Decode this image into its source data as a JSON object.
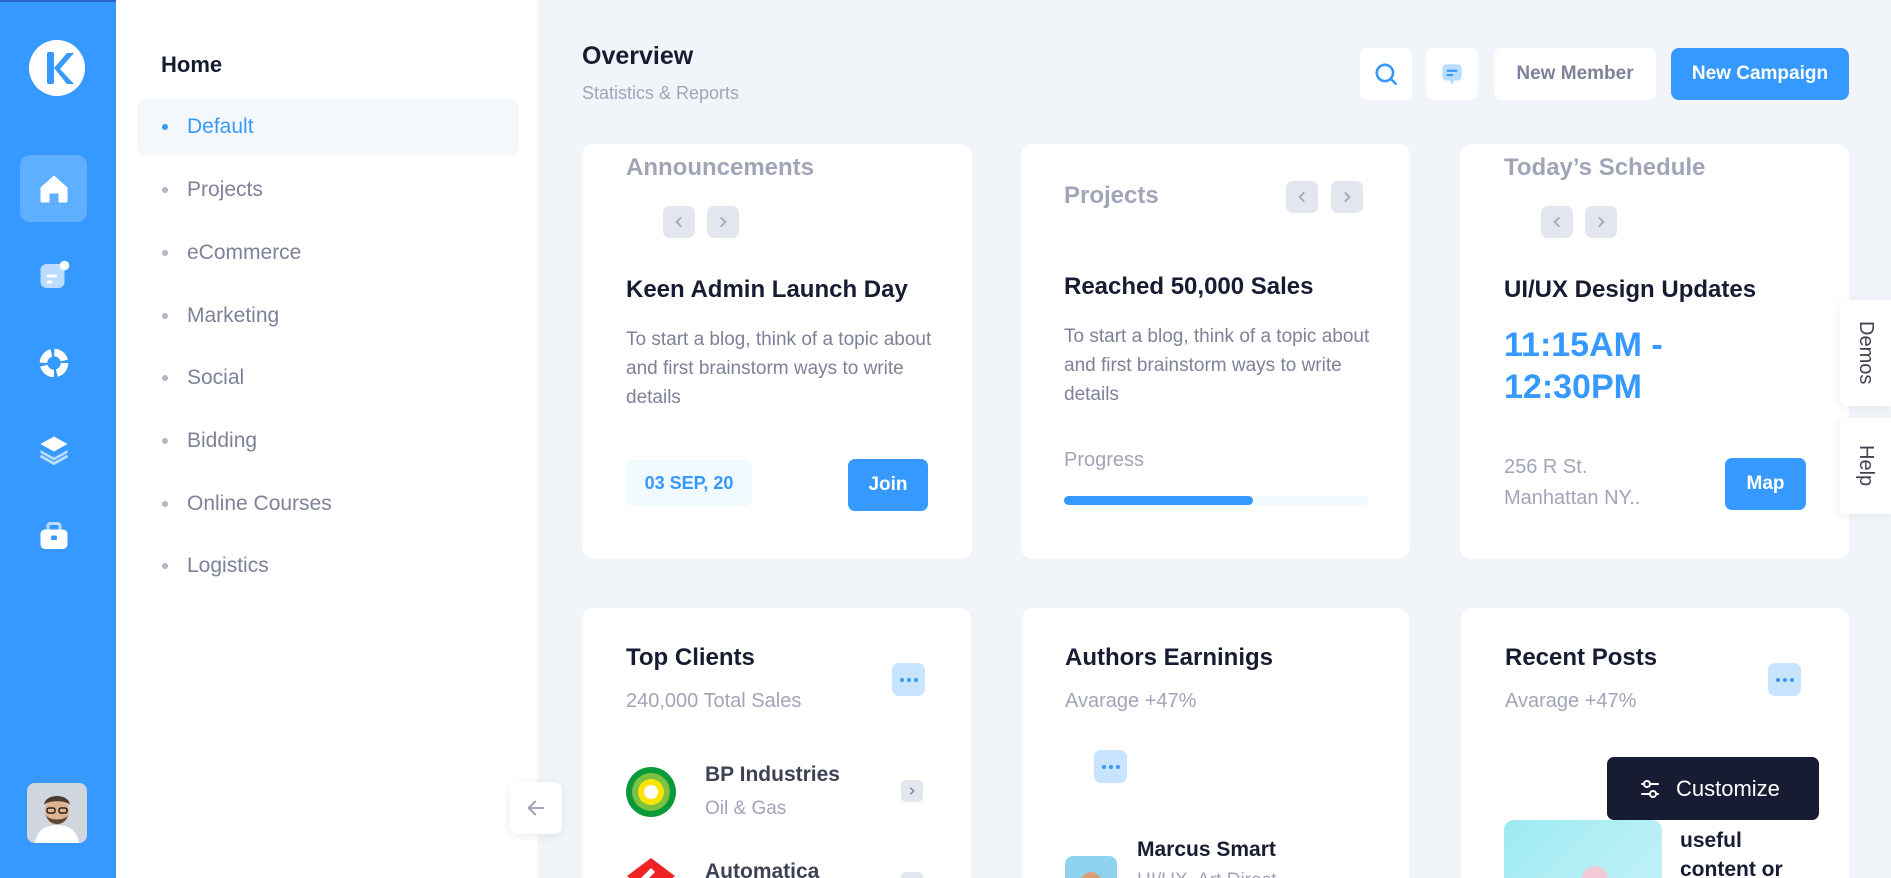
{
  "menu": {
    "title": "Home",
    "items": [
      {
        "label": "Default"
      },
      {
        "label": "Projects"
      },
      {
        "label": "eCommerce"
      },
      {
        "label": "Marketing"
      },
      {
        "label": "Social"
      },
      {
        "label": "Bidding"
      },
      {
        "label": "Online Courses"
      },
      {
        "label": "Logistics"
      }
    ]
  },
  "header": {
    "title": "Overview",
    "subtitle": "Statistics & Reports",
    "new_member_label": "New Member",
    "new_campaign_label": "New Campaign"
  },
  "announcements": {
    "heading": "Announcements",
    "title": "Keen Admin Launch Day",
    "text": "To start a blog, think of a topic about and first brainstorm ways to write details",
    "date": "03 SEP, 20",
    "join_label": "Join"
  },
  "projects": {
    "heading": "Projects",
    "title": "Reached 50,000 Sales",
    "text": "To start a blog, think of a topic about and first brainstorm ways to write details",
    "progress_label": "Progress",
    "progress_percent": 62
  },
  "schedule": {
    "heading": "Today’s Schedule",
    "title": "UI/UX Design Updates",
    "time": "11:15AM - 12:30PM",
    "address_line1": "256 R St.",
    "address_line2": "Manhattan NY..",
    "map_label": "Map"
  },
  "top_clients": {
    "title": "Top Clients",
    "subtitle": "240,000 Total Sales",
    "clients": [
      {
        "name": "BP Industries",
        "sector": "Oil & Gas"
      },
      {
        "name": "Automatica",
        "sector": ""
      }
    ]
  },
  "authors": {
    "title": "Authors Earninigs",
    "subtitle": "Avarage +47%",
    "author_name": "Marcus Smart",
    "author_role": "UI/UX, Art Direct"
  },
  "recent_posts": {
    "title": "Recent Posts",
    "subtitle": "Avarage +47%",
    "post_text": "useful content or"
  },
  "side_tabs": {
    "demos": "Demos",
    "help": "Help"
  },
  "customize_label": "Customize",
  "colors": {
    "primary": "#3699ff",
    "dark": "#181c32",
    "muted": "#a1a5b7"
  }
}
